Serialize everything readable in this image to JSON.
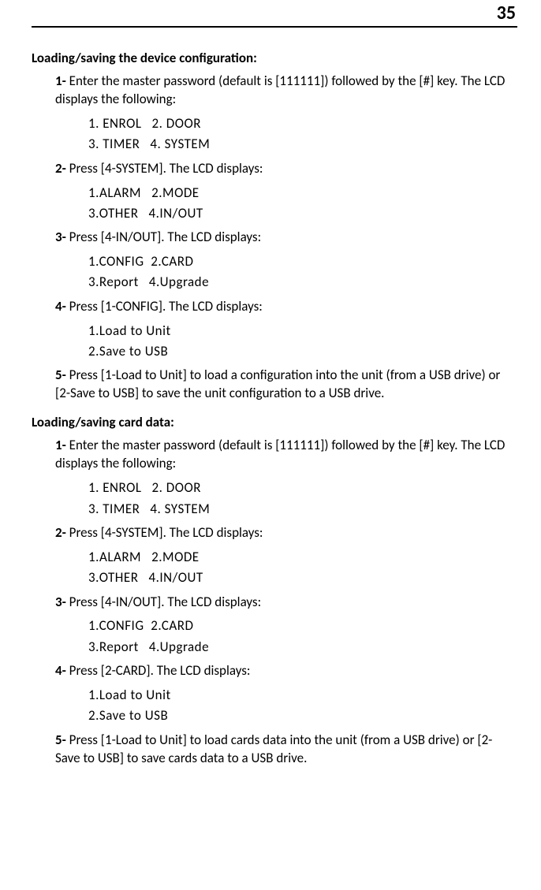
{
  "page_number": "35",
  "sections": [
    {
      "title": "Loading/saving the device configuration:",
      "steps": [
        {
          "num": "1-",
          "text": "Enter the master password (default is [111111]) followed by the [#] key. The LCD displays the following:",
          "lcd": [
            "1. ENROL   2. DOOR",
            "3. TIMER   4. SYSTEM"
          ]
        },
        {
          "num": "2-",
          "text": "Press [4-SYSTEM]. The LCD displays:",
          "lcd": [
            "1.ALARM   2.MODE",
            "3.OTHER   4.IN/OUT"
          ]
        },
        {
          "num": "3-",
          "text": "Press [4-IN/OUT]. The LCD displays:",
          "lcd": [
            "1.CONFIG  2.CARD",
            "3.Report   4.Upgrade"
          ]
        },
        {
          "num": "4-",
          "text": "Press [1-CONFIG]. The LCD displays:",
          "lcd": [
            "1.Load to Unit",
            "2.Save to USB"
          ]
        },
        {
          "num": "5-",
          "text": "Press [1-Load to Unit] to load a configuration into the unit (from a USB drive) or [2-Save to USB] to save the unit configuration to a USB drive.",
          "lcd": []
        }
      ]
    },
    {
      "title": "Loading/saving card data:",
      "steps": [
        {
          "num": "1-",
          "text": "Enter the master password (default is [111111]) followed by the [#] key. The LCD displays the following:",
          "lcd": [
            "1. ENROL   2. DOOR",
            "3. TIMER   4. SYSTEM"
          ]
        },
        {
          "num": "2-",
          "text": "Press [4-SYSTEM]. The LCD displays:",
          "lcd": [
            "1.ALARM   2.MODE",
            "3.OTHER   4.IN/OUT"
          ]
        },
        {
          "num": "3-",
          "text": "Press [4-IN/OUT]. The LCD displays:",
          "lcd": [
            "1.CONFIG  2.CARD",
            "3.Report   4.Upgrade"
          ]
        },
        {
          "num": "4-",
          "text": "Press [2-CARD]. The LCD displays:",
          "lcd": [
            "1.Load to Unit",
            "2.Save to USB"
          ]
        },
        {
          "num": "5-",
          "text": "Press [1-Load to Unit] to load cards data into the unit (from a USB drive) or [2-Save to USB] to save cards data to a USB drive.",
          "lcd": []
        }
      ]
    }
  ]
}
